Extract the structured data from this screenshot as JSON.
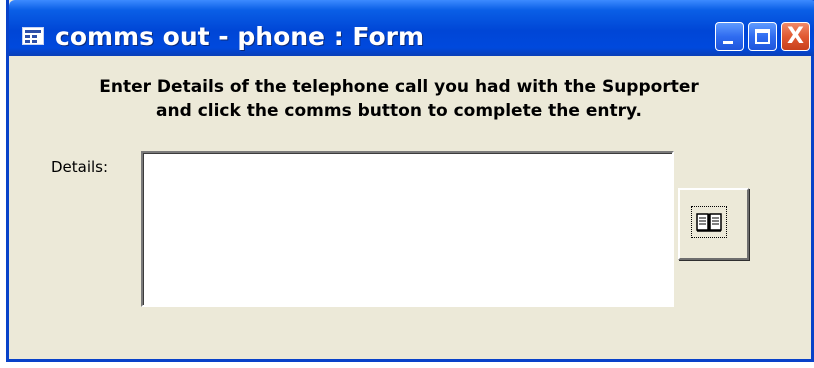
{
  "window": {
    "title": "comms out - phone : Form",
    "icon": "form-icon",
    "controls": {
      "minimize": "minimize-icon",
      "maximize": "maximize-icon",
      "close": "close-icon",
      "close_glyph": "X"
    }
  },
  "form": {
    "instructions_line1": "Enter Details of the telephone call you had with the Supporter",
    "instructions_line2": "and click the comms button to complete the entry.",
    "details_label": "Details:",
    "details_value": "",
    "comms_button_icon": "book-icon"
  },
  "colors": {
    "titlebar": "#0046d6",
    "window_border": "#0842c9",
    "form_background": "#ece9d8",
    "close_button": "#e15a32"
  }
}
